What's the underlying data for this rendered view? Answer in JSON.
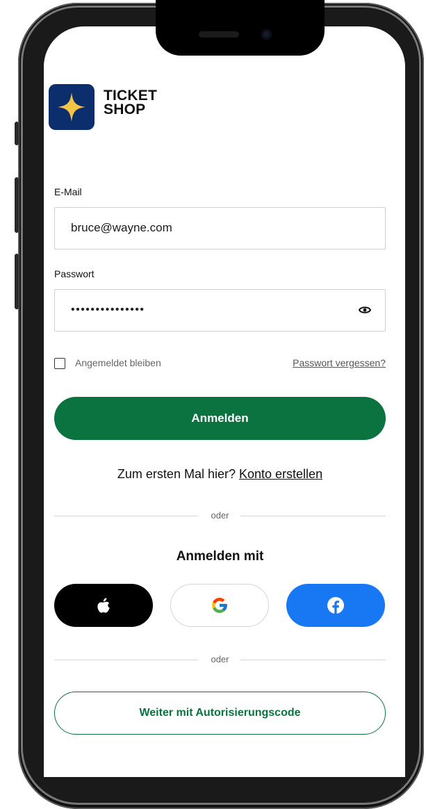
{
  "brand": {
    "line1": "TICKET",
    "line2": "SHOP",
    "logo_icon": "star-icon",
    "logo_color": "#0d2e6d",
    "star_color": "#f6c444"
  },
  "email": {
    "label": "E-Mail",
    "value": "bruce@wayne.com"
  },
  "password": {
    "label": "Passwort",
    "masked_value": "•••••••••••••••",
    "toggle_icon": "eye-icon"
  },
  "remember": {
    "label": "Angemeldet bleiben",
    "checked": false
  },
  "forgot_link": "Passwort vergessen?",
  "login_button": "Anmelden",
  "signup": {
    "prompt": "Zum ersten Mal hier?",
    "link": "Konto erstellen"
  },
  "divider_text": "oder",
  "social": {
    "title": "Anmelden mit",
    "providers": [
      {
        "name": "Apple",
        "icon": "apple-icon"
      },
      {
        "name": "Google",
        "icon": "google-icon"
      },
      {
        "name": "Facebook",
        "icon": "facebook-icon"
      }
    ]
  },
  "auth_code_button": "Weiter mit Autorisierungscode",
  "colors": {
    "primary": "#0a7340",
    "facebook": "#1877f2",
    "apple": "#000000"
  }
}
